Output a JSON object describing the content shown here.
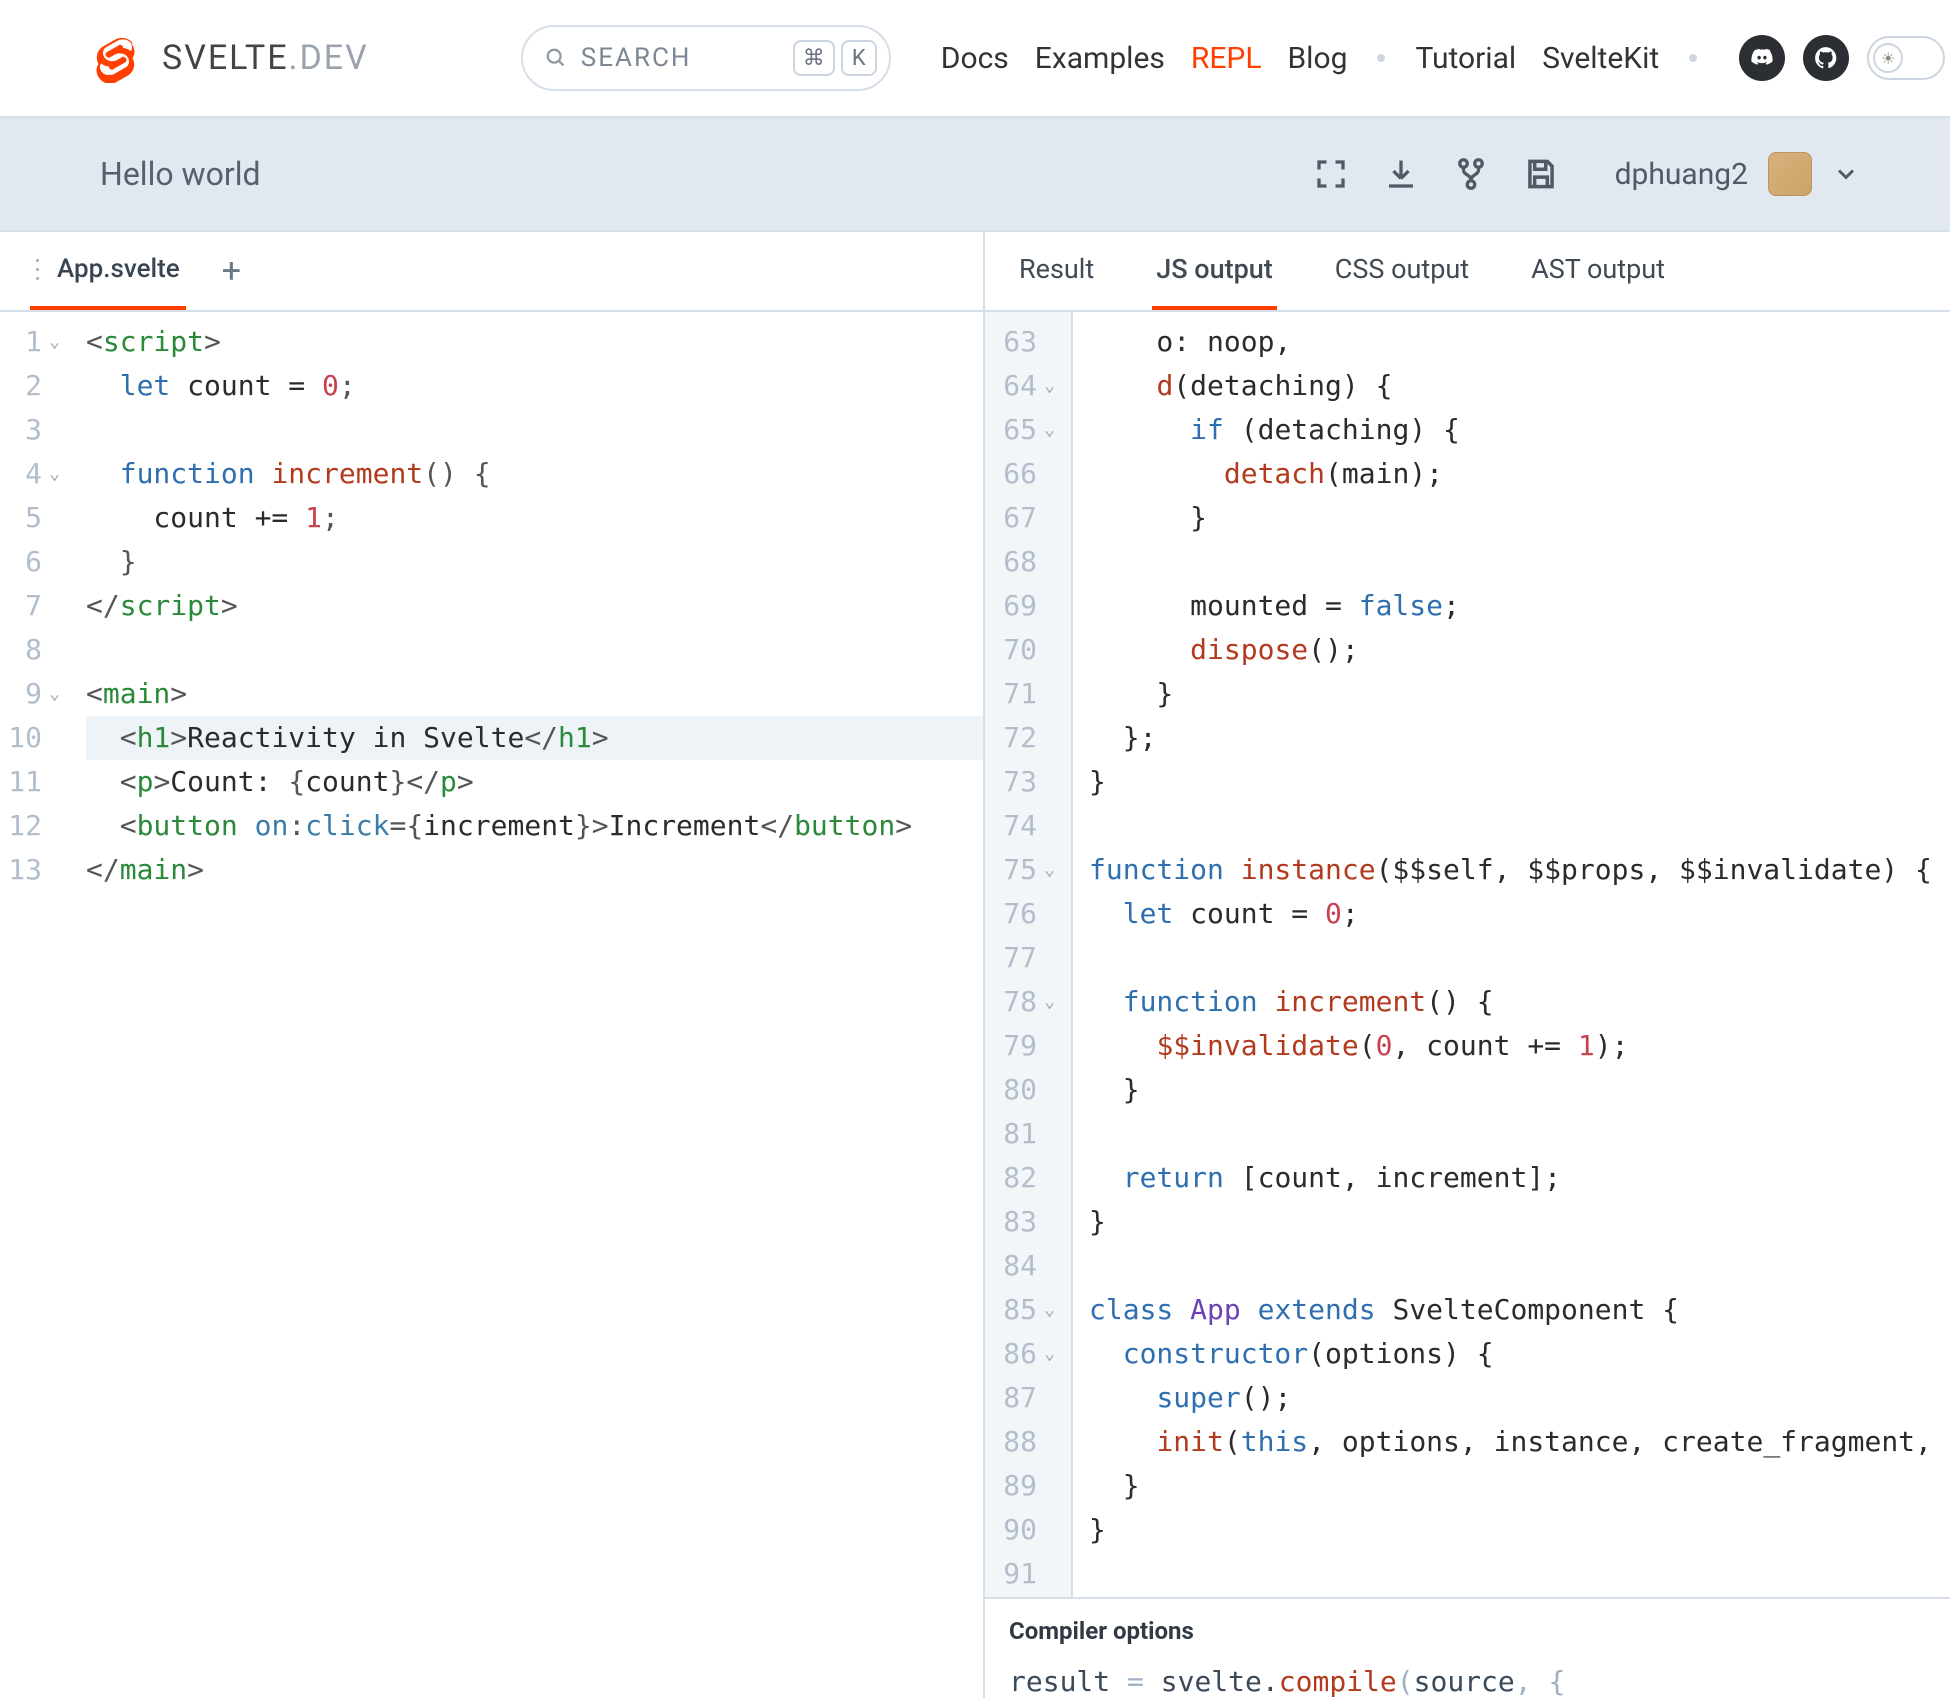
{
  "brand": {
    "name": "SVELTE",
    "suffix": ".DEV"
  },
  "search": {
    "placeholder": "SEARCH",
    "keys": [
      "⌘",
      "K"
    ]
  },
  "nav": {
    "items": [
      {
        "label": "Docs",
        "active": false
      },
      {
        "label": "Examples",
        "active": false
      },
      {
        "label": "REPL",
        "active": true
      },
      {
        "label": "Blog",
        "active": false,
        "sep_after": true
      },
      {
        "label": "Tutorial",
        "active": false
      },
      {
        "label": "SvelteKit",
        "active": false,
        "sep_after": true
      }
    ]
  },
  "repl": {
    "title": "Hello world",
    "user": "dphuang2",
    "file_tabs": [
      {
        "label": "App.svelte",
        "active": true
      }
    ],
    "output_tabs": [
      {
        "label": "Result",
        "active": false
      },
      {
        "label": "JS output",
        "active": true
      },
      {
        "label": "CSS output",
        "active": false
      },
      {
        "label": "AST output",
        "active": false
      }
    ],
    "compiler_options_label": "Compiler options",
    "compiler_snippet_tokens": [
      {
        "t": "result ",
        "c": "plain"
      },
      {
        "t": "= ",
        "c": "fade"
      },
      {
        "t": "svelte.",
        "c": "plain"
      },
      {
        "t": "compile",
        "c": "fn"
      },
      {
        "t": "(",
        "c": "fade"
      },
      {
        "t": "source",
        "c": "plain"
      },
      {
        "t": ", {",
        "c": "fade"
      }
    ]
  },
  "editor_left": {
    "highlight_line": 10,
    "lines": [
      {
        "n": 1,
        "fold": true,
        "tokens": [
          {
            "t": "<",
            "c": "punc"
          },
          {
            "t": "script",
            "c": "tag"
          },
          {
            "t": ">",
            "c": "punc"
          }
        ]
      },
      {
        "n": 2,
        "tokens": [
          {
            "t": "  ",
            "c": "plain"
          },
          {
            "t": "let",
            "c": "kw"
          },
          {
            "t": " count = ",
            "c": "plain"
          },
          {
            "t": "0",
            "c": "num"
          },
          {
            "t": ";",
            "c": "punc"
          }
        ]
      },
      {
        "n": 3,
        "tokens": []
      },
      {
        "n": 4,
        "fold": true,
        "tokens": [
          {
            "t": "  ",
            "c": "plain"
          },
          {
            "t": "function",
            "c": "kw"
          },
          {
            "t": " ",
            "c": "plain"
          },
          {
            "t": "increment",
            "c": "fn"
          },
          {
            "t": "() {",
            "c": "punc"
          }
        ]
      },
      {
        "n": 5,
        "tokens": [
          {
            "t": "    count += ",
            "c": "plain"
          },
          {
            "t": "1",
            "c": "num"
          },
          {
            "t": ";",
            "c": "punc"
          }
        ]
      },
      {
        "n": 6,
        "tokens": [
          {
            "t": "  }",
            "c": "punc"
          }
        ]
      },
      {
        "n": 7,
        "tokens": [
          {
            "t": "</",
            "c": "punc"
          },
          {
            "t": "script",
            "c": "tag"
          },
          {
            "t": ">",
            "c": "punc"
          }
        ]
      },
      {
        "n": 8,
        "tokens": []
      },
      {
        "n": 9,
        "fold": true,
        "tokens": [
          {
            "t": "<",
            "c": "punc"
          },
          {
            "t": "main",
            "c": "tag"
          },
          {
            "t": ">",
            "c": "punc"
          }
        ]
      },
      {
        "n": 10,
        "tokens": [
          {
            "t": "  <",
            "c": "punc"
          },
          {
            "t": "h1",
            "c": "tag"
          },
          {
            "t": ">",
            "c": "punc"
          },
          {
            "t": "Reactivity in Svelte",
            "c": "plain"
          },
          {
            "t": "</",
            "c": "punc"
          },
          {
            "t": "h1",
            "c": "tag"
          },
          {
            "t": ">",
            "c": "punc"
          }
        ]
      },
      {
        "n": 11,
        "tokens": [
          {
            "t": "  <",
            "c": "punc"
          },
          {
            "t": "p",
            "c": "tag"
          },
          {
            "t": ">",
            "c": "punc"
          },
          {
            "t": "Count: ",
            "c": "plain"
          },
          {
            "t": "{",
            "c": "punc"
          },
          {
            "t": "count",
            "c": "plain"
          },
          {
            "t": "}",
            "c": "punc"
          },
          {
            "t": "</",
            "c": "punc"
          },
          {
            "t": "p",
            "c": "tag"
          },
          {
            "t": ">",
            "c": "punc"
          }
        ]
      },
      {
        "n": 12,
        "tokens": [
          {
            "t": "  <",
            "c": "punc"
          },
          {
            "t": "button",
            "c": "tag"
          },
          {
            "t": " ",
            "c": "plain"
          },
          {
            "t": "on",
            "c": "attr"
          },
          {
            "t": ":",
            "c": "punc"
          },
          {
            "t": "click",
            "c": "attr"
          },
          {
            "t": "=",
            "c": "punc"
          },
          {
            "t": "{",
            "c": "punc"
          },
          {
            "t": "increment",
            "c": "plain"
          },
          {
            "t": "}",
            "c": "punc"
          },
          {
            "t": ">",
            "c": "punc"
          },
          {
            "t": "Increment",
            "c": "plain"
          },
          {
            "t": "</",
            "c": "punc"
          },
          {
            "t": "button",
            "c": "tag"
          },
          {
            "t": ">",
            "c": "punc"
          }
        ]
      },
      {
        "n": 13,
        "tokens": [
          {
            "t": "</",
            "c": "punc"
          },
          {
            "t": "main",
            "c": "tag"
          },
          {
            "t": ">",
            "c": "punc"
          }
        ]
      }
    ]
  },
  "editor_right": {
    "lines": [
      {
        "n": 63,
        "tokens": [
          {
            "t": "    o: noop,",
            "c": "plain"
          }
        ]
      },
      {
        "n": 64,
        "fold": true,
        "tokens": [
          {
            "t": "    ",
            "c": "plain"
          },
          {
            "t": "d",
            "c": "fn"
          },
          {
            "t": "(detaching) {",
            "c": "plain"
          }
        ]
      },
      {
        "n": 65,
        "fold": true,
        "tokens": [
          {
            "t": "      ",
            "c": "plain"
          },
          {
            "t": "if",
            "c": "kw"
          },
          {
            "t": " (detaching) {",
            "c": "plain"
          }
        ]
      },
      {
        "n": 66,
        "tokens": [
          {
            "t": "        ",
            "c": "plain"
          },
          {
            "t": "detach",
            "c": "fn"
          },
          {
            "t": "(main);",
            "c": "plain"
          }
        ]
      },
      {
        "n": 67,
        "tokens": [
          {
            "t": "      }",
            "c": "plain"
          }
        ]
      },
      {
        "n": 68,
        "tokens": []
      },
      {
        "n": 69,
        "tokens": [
          {
            "t": "      mounted = ",
            "c": "plain"
          },
          {
            "t": "false",
            "c": "kw"
          },
          {
            "t": ";",
            "c": "plain"
          }
        ]
      },
      {
        "n": 70,
        "tokens": [
          {
            "t": "      ",
            "c": "plain"
          },
          {
            "t": "dispose",
            "c": "fn"
          },
          {
            "t": "();",
            "c": "plain"
          }
        ]
      },
      {
        "n": 71,
        "tokens": [
          {
            "t": "    }",
            "c": "plain"
          }
        ]
      },
      {
        "n": 72,
        "tokens": [
          {
            "t": "  };",
            "c": "plain"
          }
        ]
      },
      {
        "n": 73,
        "tokens": [
          {
            "t": "}",
            "c": "plain"
          }
        ]
      },
      {
        "n": 74,
        "tokens": []
      },
      {
        "n": 75,
        "fold": true,
        "tokens": [
          {
            "t": "function",
            "c": "kw"
          },
          {
            "t": " ",
            "c": "plain"
          },
          {
            "t": "instance",
            "c": "fn"
          },
          {
            "t": "($$self, $$props, $$invalidate) {",
            "c": "plain"
          }
        ]
      },
      {
        "n": 76,
        "tokens": [
          {
            "t": "  ",
            "c": "plain"
          },
          {
            "t": "let",
            "c": "kw"
          },
          {
            "t": " count = ",
            "c": "plain"
          },
          {
            "t": "0",
            "c": "num"
          },
          {
            "t": ";",
            "c": "plain"
          }
        ]
      },
      {
        "n": 77,
        "tokens": []
      },
      {
        "n": 78,
        "fold": true,
        "tokens": [
          {
            "t": "  ",
            "c": "plain"
          },
          {
            "t": "function",
            "c": "kw"
          },
          {
            "t": " ",
            "c": "plain"
          },
          {
            "t": "increment",
            "c": "fn"
          },
          {
            "t": "() {",
            "c": "plain"
          }
        ]
      },
      {
        "n": 79,
        "tokens": [
          {
            "t": "    ",
            "c": "plain"
          },
          {
            "t": "$$invalidate",
            "c": "fn"
          },
          {
            "t": "(",
            "c": "plain"
          },
          {
            "t": "0",
            "c": "num"
          },
          {
            "t": ", count += ",
            "c": "plain"
          },
          {
            "t": "1",
            "c": "num"
          },
          {
            "t": ");",
            "c": "plain"
          }
        ]
      },
      {
        "n": 80,
        "tokens": [
          {
            "t": "  }",
            "c": "plain"
          }
        ]
      },
      {
        "n": 81,
        "tokens": []
      },
      {
        "n": 82,
        "tokens": [
          {
            "t": "  ",
            "c": "plain"
          },
          {
            "t": "return",
            "c": "kw"
          },
          {
            "t": " [count, increment];",
            "c": "plain"
          }
        ]
      },
      {
        "n": 83,
        "tokens": [
          {
            "t": "}",
            "c": "plain"
          }
        ]
      },
      {
        "n": 84,
        "tokens": []
      },
      {
        "n": 85,
        "fold": true,
        "tokens": [
          {
            "t": "class",
            "c": "kw"
          },
          {
            "t": " ",
            "c": "plain"
          },
          {
            "t": "App",
            "c": "cls"
          },
          {
            "t": " ",
            "c": "plain"
          },
          {
            "t": "extends",
            "c": "kw"
          },
          {
            "t": " SvelteComponent {",
            "c": "plain"
          }
        ]
      },
      {
        "n": 86,
        "fold": true,
        "tokens": [
          {
            "t": "  ",
            "c": "plain"
          },
          {
            "t": "constructor",
            "c": "kw"
          },
          {
            "t": "(options) {",
            "c": "plain"
          }
        ]
      },
      {
        "n": 87,
        "tokens": [
          {
            "t": "    ",
            "c": "plain"
          },
          {
            "t": "super",
            "c": "kw"
          },
          {
            "t": "();",
            "c": "plain"
          }
        ]
      },
      {
        "n": 88,
        "tokens": [
          {
            "t": "    ",
            "c": "plain"
          },
          {
            "t": "init",
            "c": "fn"
          },
          {
            "t": "(",
            "c": "plain"
          },
          {
            "t": "this",
            "c": "kw"
          },
          {
            "t": ", options, instance, create_fragment, safe_no",
            "c": "plain"
          }
        ]
      },
      {
        "n": 89,
        "tokens": [
          {
            "t": "  }",
            "c": "plain"
          }
        ]
      },
      {
        "n": 90,
        "tokens": [
          {
            "t": "}",
            "c": "plain"
          }
        ]
      },
      {
        "n": 91,
        "tokens": []
      }
    ]
  }
}
